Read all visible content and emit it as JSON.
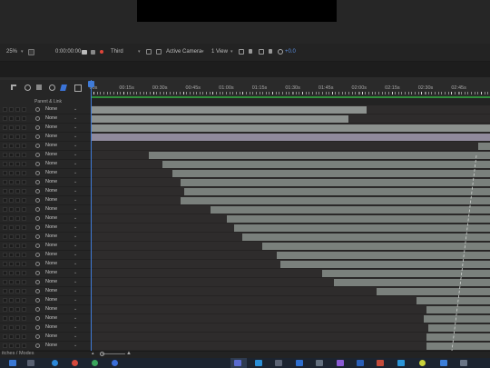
{
  "viewer_toolbar": {
    "zoom": "25%",
    "timecode": "0:00:00:00",
    "resolution": "Third",
    "camera": "Active Camera",
    "views": "1 View",
    "exposure": "+0.0"
  },
  "timeline": {
    "ruler_labels": [
      "00s",
      "00:15s",
      "00:30s",
      "00:45s",
      "01:00s",
      "01:15s",
      "01:30s",
      "01:45s",
      "02:00s",
      "02:15s",
      "02:30s",
      "02:45s"
    ],
    "column_header": "Parent & Link",
    "parent_default": "None",
    "layers": [
      {
        "parent": "None",
        "bar": [
          0.0,
          0.69
        ]
      },
      {
        "parent": "None",
        "bar": [
          0.0,
          0.645
        ]
      },
      {
        "parent": "None",
        "bar": [
          0.0,
          1.0
        ]
      },
      {
        "parent": "None",
        "bar": [
          0.0,
          1.0
        ],
        "style": "purple"
      },
      {
        "parent": "None",
        "bar": [
          0.97,
          1.0
        ]
      },
      {
        "parent": "None",
        "bar": [
          0.145,
          1.0
        ]
      },
      {
        "parent": "None",
        "bar": [
          0.18,
          1.0
        ]
      },
      {
        "parent": "None",
        "bar": [
          0.205,
          1.0
        ]
      },
      {
        "parent": "None",
        "bar": [
          0.225,
          1.0
        ]
      },
      {
        "parent": "None",
        "bar": [
          0.235,
          1.0
        ]
      },
      {
        "parent": "None",
        "bar": [
          0.225,
          1.0
        ]
      },
      {
        "parent": "None",
        "bar": [
          0.3,
          1.0
        ]
      },
      {
        "parent": "None",
        "bar": [
          0.34,
          1.0
        ]
      },
      {
        "parent": "None",
        "bar": [
          0.36,
          1.0
        ]
      },
      {
        "parent": "None",
        "bar": [
          0.38,
          1.0
        ]
      },
      {
        "parent": "None",
        "bar": [
          0.43,
          1.0
        ]
      },
      {
        "parent": "None",
        "bar": [
          0.465,
          1.0
        ]
      },
      {
        "parent": "None",
        "bar": [
          0.475,
          1.0
        ]
      },
      {
        "parent": "None",
        "bar": [
          0.58,
          1.0
        ]
      },
      {
        "parent": "None",
        "bar": [
          0.61,
          1.0
        ]
      },
      {
        "parent": "None",
        "bar": [
          0.715,
          1.0
        ]
      },
      {
        "parent": "None",
        "bar": [
          0.815,
          1.0
        ]
      },
      {
        "parent": "None",
        "bar": [
          0.84,
          1.0
        ]
      },
      {
        "parent": "None",
        "bar": [
          0.835,
          1.0
        ]
      },
      {
        "parent": "None",
        "bar": [
          0.845,
          1.0
        ]
      },
      {
        "parent": "None",
        "bar": [
          0.84,
          1.0
        ]
      },
      {
        "parent": "None",
        "bar": [
          0.84,
          1.0
        ]
      }
    ]
  },
  "footer": {
    "label": "itches / Modes"
  },
  "colors": {
    "playhead": "#3f7bd8",
    "work_area": "#2f8f3a",
    "layer_bar": "#7a807c"
  }
}
